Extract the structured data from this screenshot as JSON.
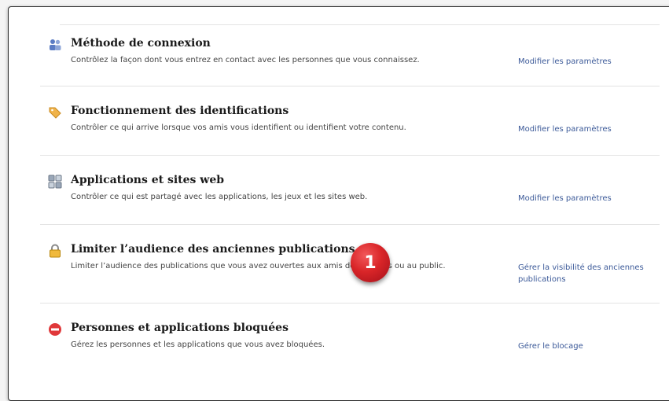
{
  "sections": [
    {
      "icon": "people-icon",
      "title": "Méthode de connexion",
      "description": "Contrôlez la façon dont vous entrez en contact avec les personnes que vous connaissez.",
      "link": "Modifier les paramètres"
    },
    {
      "icon": "tag-icon",
      "title": "Fonctionnement des identifications",
      "description": "Contrôler ce qui arrive lorsque vos amis vous identifient ou identifient votre contenu.",
      "link": "Modifier les paramètres"
    },
    {
      "icon": "apps-icon",
      "title": "Applications et sites web",
      "description": "Contrôler ce qui est partagé avec les applications, les jeux et les sites web.",
      "link": "Modifier les paramètres"
    },
    {
      "icon": "lock-icon",
      "title": "Limiter l’audience des anciennes publications",
      "description": "Limiter l’audience des publications que vous avez ouvertes aux amis de vos amis ou au public.",
      "link": "Gérer la visibilité des anciennes publications"
    },
    {
      "icon": "blocked-icon",
      "title": "Personnes et applications bloquées",
      "description": "Gérez les personnes et les applications que vous avez bloquées.",
      "link": "Gérer le blocage"
    }
  ],
  "annotation": {
    "number": "1",
    "color": "#d92528"
  },
  "colors": {
    "link": "#3b5998",
    "divider": "#e3e3e3"
  }
}
